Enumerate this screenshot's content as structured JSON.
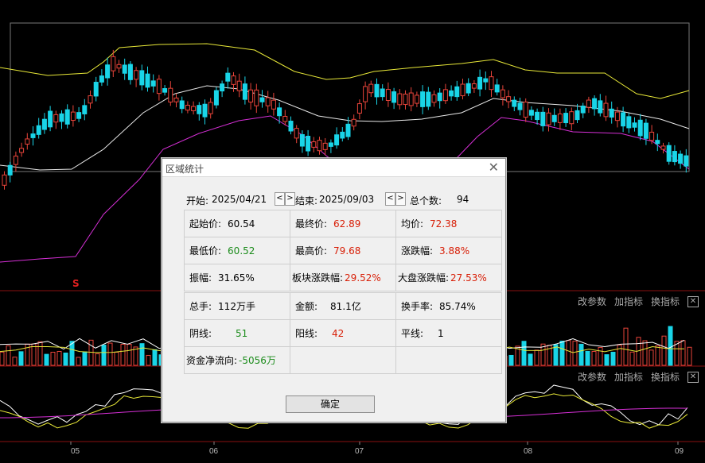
{
  "axis_months": [
    "05",
    "06",
    "07",
    "08",
    "09"
  ],
  "marker_symbol": "S",
  "panel1_tools": {
    "params": "改参数",
    "add_indicator": "加指标",
    "switch_indicator": "换指标"
  },
  "panel2_tools": {
    "params": "改参数",
    "add_indicator": "加指标",
    "switch_indicator": "换指标"
  },
  "colors": {
    "up": "#e8443a",
    "down": "#19d5e8",
    "upper_band": "#e8e838",
    "mid_band": "#e8e8e8",
    "lower_band": "#d62fd6",
    "gain": "#d81e06",
    "loss": "#1c8c1c"
  },
  "dialog": {
    "title": "区域统计",
    "start_label": "开始:",
    "start_date": "2025/04/21",
    "end_label": "结束:",
    "end_date": "2025/09/03",
    "count_label": "总个数:",
    "count": "94",
    "prev_symbol": "<",
    "next_symbol": ">",
    "stats": [
      [
        {
          "label": "起始价:",
          "value": "60.54",
          "color": "black"
        },
        {
          "label": "最终价:",
          "value": "62.89",
          "color": "red"
        },
        {
          "label": "均价:",
          "value": "72.38",
          "color": "red"
        }
      ],
      [
        {
          "label": "最低价:",
          "value": "60.52",
          "color": "green"
        },
        {
          "label": "最高价:",
          "value": "79.68",
          "color": "red"
        },
        {
          "label": "涨跌幅:",
          "value": "3.88%",
          "color": "red"
        }
      ],
      [
        {
          "label": "振幅:",
          "value": "31.65%",
          "color": "black"
        },
        {
          "label": "板块涨跌幅:",
          "value": "29.52%",
          "color": "red"
        },
        {
          "label": "大盘涨跌幅:",
          "value": "27.53%",
          "color": "red"
        }
      ]
    ],
    "stats2": [
      [
        {
          "label": "总手:",
          "value": "112万手",
          "color": "black"
        },
        {
          "label": "金额:",
          "value": "81.1亿",
          "color": "black"
        },
        {
          "label": "换手率:",
          "value": "85.74%",
          "color": "black"
        }
      ],
      [
        {
          "label": "阴线:",
          "value": "51",
          "color": "green"
        },
        {
          "label": "阳线:",
          "value": "42",
          "color": "red"
        },
        {
          "label": "平线:",
          "value": "1",
          "color": "black"
        }
      ],
      [
        {
          "label": "资金净流向:",
          "value": "-5056万",
          "color": "green"
        },
        {
          "label": "",
          "value": "",
          "color": "black"
        },
        {
          "label": "",
          "value": "",
          "color": "black"
        }
      ]
    ],
    "ok_label": "确定"
  }
}
